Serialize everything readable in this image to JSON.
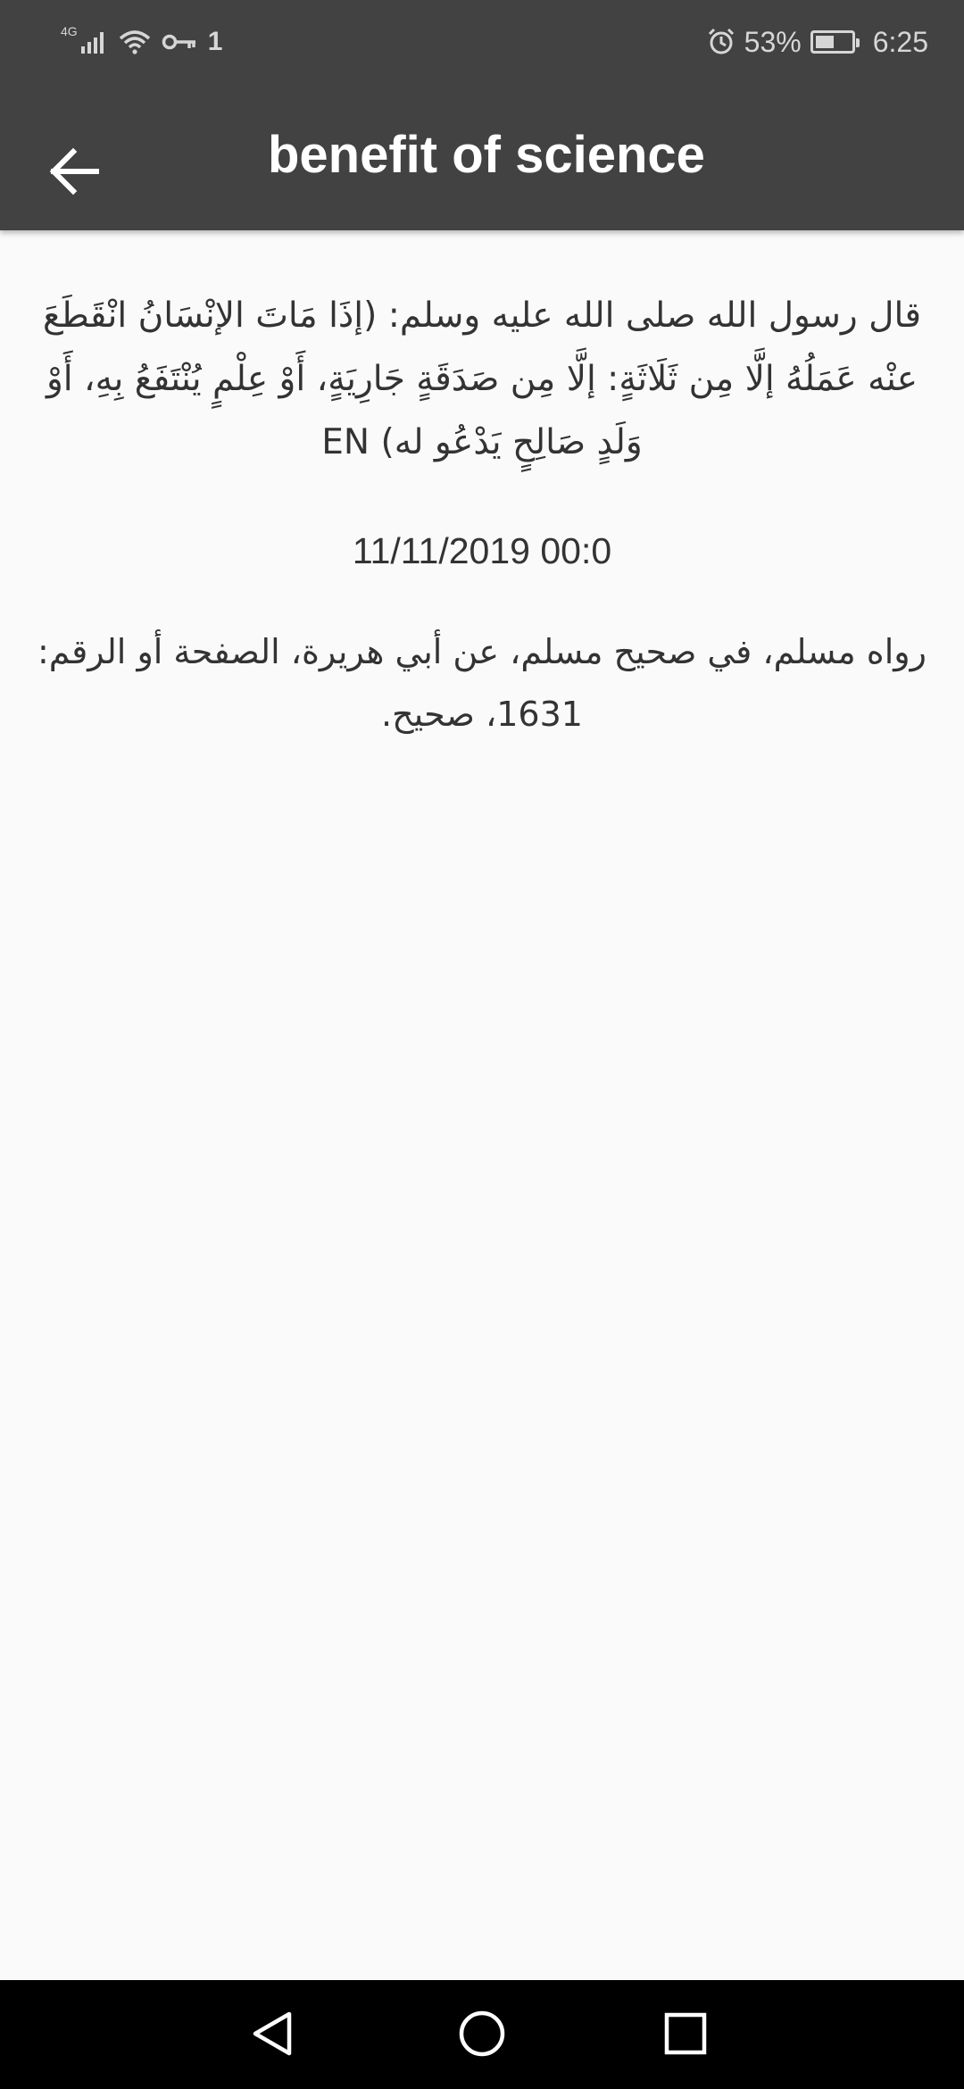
{
  "status_bar": {
    "network": "4G",
    "sim_indicator": "1",
    "alarm_icon": "alarm-icon",
    "battery_level": "53%",
    "battery_fraction": 0.53,
    "time": "6:25"
  },
  "toolbar": {
    "back_icon": "arrow-back-icon",
    "title": "benefit of science"
  },
  "content": {
    "hadith": "قال رسول الله صلى الله عليه وسلم: (إذَا مَاتَ الإنْسَانُ انْقَطَعَ عنْه عَمَلُهُ إلَّا مِن ثَلَاثَةٍ: إلَّا مِن صَدَقَةٍ جَارِيَةٍ، أَوْ عِلْمٍ يُنْتَفَعُ بِهِ، أَوْ وَلَدٍ صَالِحٍ يَدْعُو له) EN",
    "date": "11/11/2019 00:0",
    "source": "رواه مسلم، في صحيح مسلم، عن أبي هريرة، الصفحة أو الرقم: 1631، صحيح."
  },
  "navigation_bar": {
    "back_icon": "triangle-back-icon",
    "home_icon": "circle-home-icon",
    "recents_icon": "square-recents-icon"
  },
  "colors": {
    "toolbar_background": "#424242",
    "page_background": "#fafafa",
    "text": "#333333",
    "nav_background": "#000000"
  }
}
